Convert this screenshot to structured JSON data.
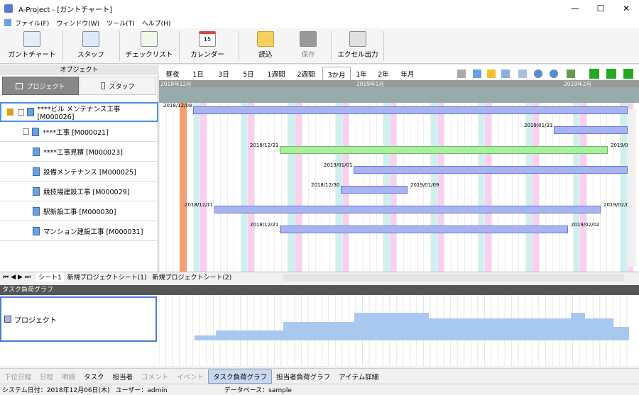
{
  "window": {
    "title": "A-Project - [ガントチャート]",
    "minimize": "—",
    "maximize": "☐",
    "close": "✕"
  },
  "menu": [
    "ファイル(F)",
    "ウィンドウ(W)",
    "ツール(T)",
    "ヘルプ(H)"
  ],
  "toolbar": [
    "ガントチャート",
    "スタッフ",
    "チェックリスト",
    "カレンダー",
    "読込",
    "保存",
    "エクセル出力"
  ],
  "calendar_icon_day": "15",
  "object_panel": {
    "header": "オブジェクト",
    "tab_project": "プロジェクト",
    "tab_staff": "スタッフ"
  },
  "projects": [
    {
      "name": "****ビル メンテナンス工事 [M000026]",
      "start": "2018/12/08",
      "end": ""
    },
    {
      "name": "****工事 [M000021]",
      "start": "2019/01/31",
      "end": ""
    },
    {
      "name": "****工事見積 [M000023]",
      "start": "2018/12/21",
      "end": "2019/02"
    },
    {
      "name": "設備メンテナンス [M000025]",
      "start": "2019/01/01",
      "end": ""
    },
    {
      "name": "競技場建設工事 [M000029]",
      "start": "2018/12/30",
      "end": "2019/01/09"
    },
    {
      "name": "駅新設工事 [M000030]",
      "start": "2018/12/11",
      "end": "2019/02/0"
    },
    {
      "name": "マンション建設工事 [M000031]",
      "start": "2018/12/21",
      "end": "2019/02/02"
    }
  ],
  "gantt_tabs": [
    "昼夜",
    "1日",
    "3日",
    "5日",
    "1週間",
    "2週間",
    "3か月",
    "1年",
    "2年",
    "年月"
  ],
  "gantt_active_tab": "3か月",
  "months": [
    "2018年12月",
    "2019年1月",
    "2019年2月"
  ],
  "sheet_tabs": [
    "シート1",
    "新規プロジェクトシート(1)",
    "新規プロジェクトシート(2)"
  ],
  "load_graph": {
    "header": "タスク負荷グラフ",
    "legend": "プロジェクト"
  },
  "bottom_tabs": [
    "下位日程",
    "日程",
    "明細",
    "タスク",
    "担当者",
    "コメント",
    "イベント",
    "タスク負荷グラフ",
    "担当者負荷グラフ",
    "アイテム詳細"
  ],
  "status": {
    "date": "システム日付：2018年12月06日(木)",
    "user": "ユーザー：admin",
    "db": "データベース：sample"
  },
  "colors": {
    "bar": "#a8b4f0",
    "bar_green": "#a8f0a0",
    "today": "#f5a070",
    "sat": "#d0f0f0",
    "sun": "#f8d0f0",
    "load": "#a8c8f0"
  }
}
